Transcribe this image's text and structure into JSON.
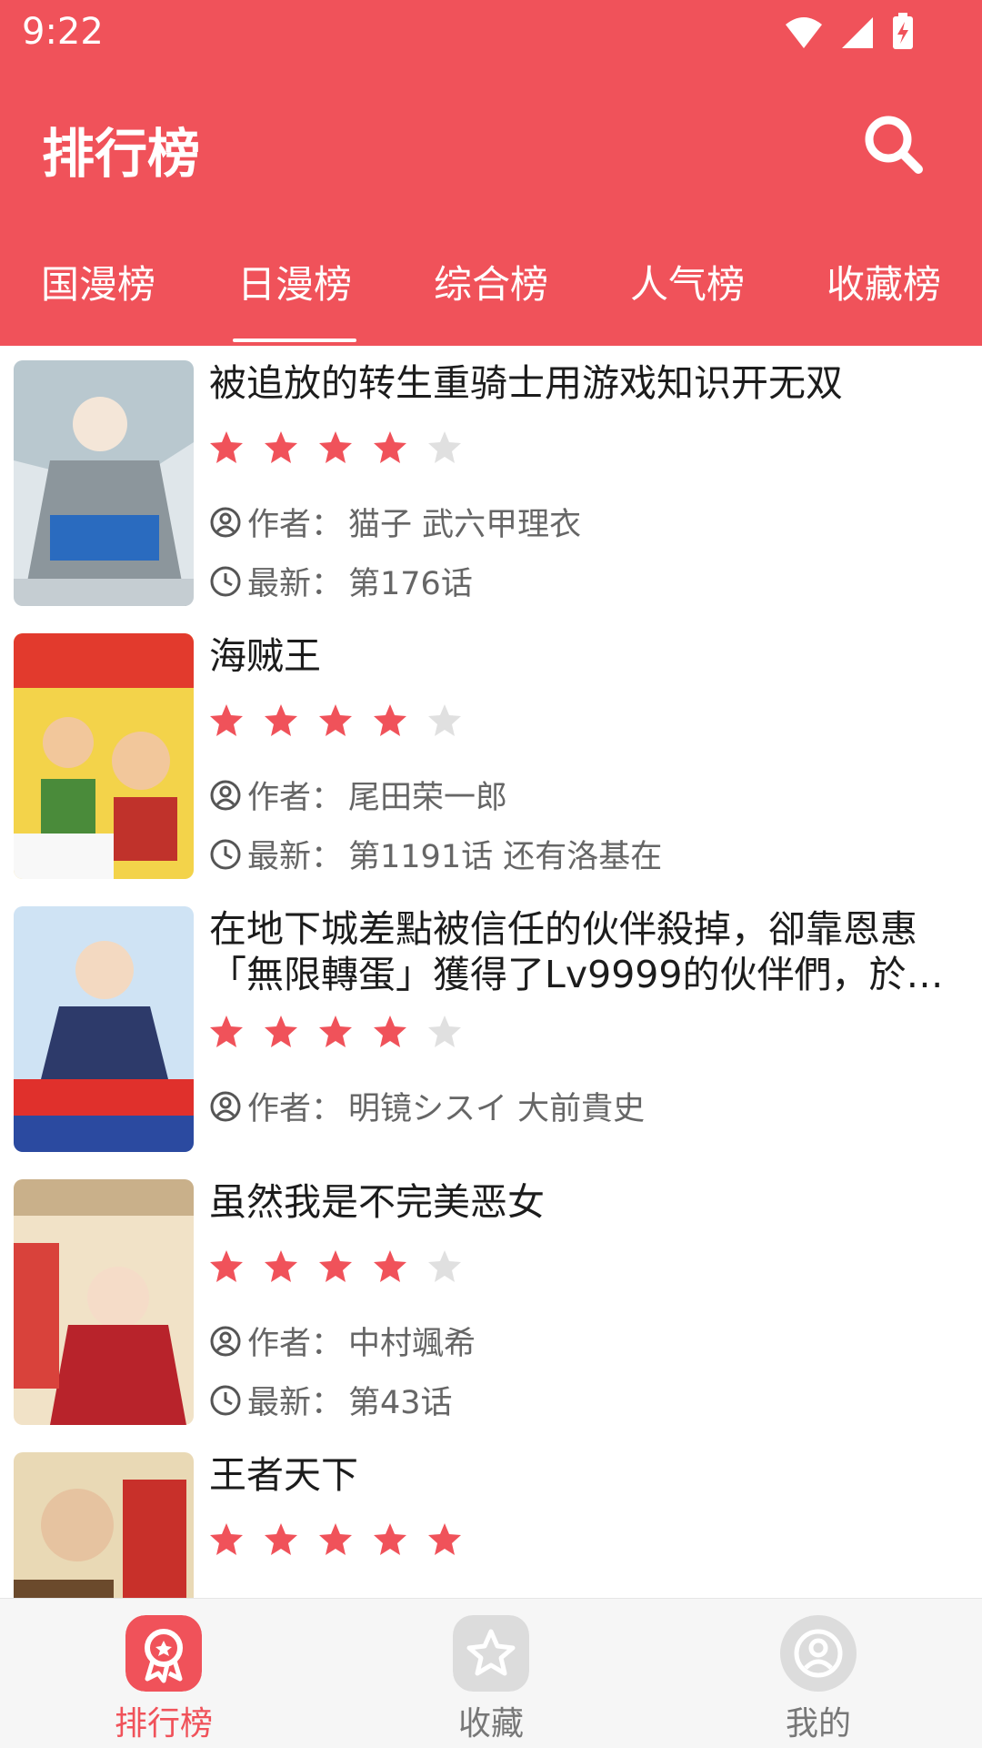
{
  "status": {
    "time": "9:22"
  },
  "header": {
    "title": "排行榜"
  },
  "tabs": [
    {
      "label": "国漫榜",
      "active": false
    },
    {
      "label": "日漫榜",
      "active": true
    },
    {
      "label": "综合榜",
      "active": false
    },
    {
      "label": "人气榜",
      "active": false
    },
    {
      "label": "收藏榜",
      "active": false
    }
  ],
  "labels": {
    "author_prefix": "作者：",
    "latest_prefix": "最新："
  },
  "comics": [
    {
      "title": "被追放的转生重骑士用游戏知识开无双",
      "rating": 4,
      "author": "猫子 武六甲理衣",
      "latest": "第176话"
    },
    {
      "title": "海贼王",
      "rating": 4,
      "author": "尾田荣一郎",
      "latest": "第1191话 还有洛基在"
    },
    {
      "title": "在地下城差點被信任的伙伴殺掉，卻靠恩惠「無限轉蛋」獲得了Lv9999的伙伴們，於…",
      "rating": 4,
      "author": "明镜シスイ 大前貴史",
      "latest": ""
    },
    {
      "title": "虽然我是不完美恶女",
      "rating": 4,
      "author": "中村颯希",
      "latest": "第43话"
    },
    {
      "title": "王者天下",
      "rating": 5,
      "author": "",
      "latest": ""
    }
  ],
  "bottom_nav": [
    {
      "label": "排行榜",
      "icon": "ranking-icon",
      "active": true
    },
    {
      "label": "收藏",
      "icon": "star-icon",
      "active": false
    },
    {
      "label": "我的",
      "icon": "profile-icon",
      "active": false
    }
  ],
  "colors": {
    "accent": "#f0525a",
    "star_on": "#f0525a",
    "star_off": "#e0e0e0"
  }
}
